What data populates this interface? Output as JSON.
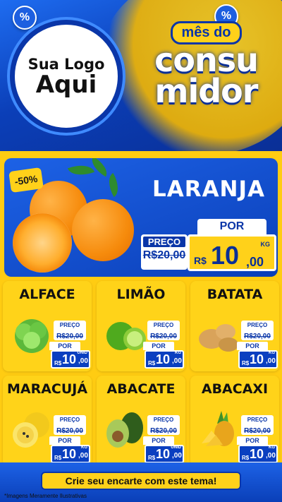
{
  "header": {
    "logo_line1": "Sua Logo",
    "logo_line2": "Aqui",
    "campaign_small": "mês do",
    "campaign_line1": "consu",
    "campaign_line2": "midor",
    "percent_icon": "%"
  },
  "featured": {
    "discount": "-50%",
    "name": "LARANJA",
    "preco_label": "PREÇO",
    "old_price": "R$20,00",
    "por_label": "POR",
    "currency": "R$",
    "price_int": "10",
    "price_dec": ",00",
    "unit": "KG"
  },
  "products": [
    {
      "name": "ALFACE",
      "preco_label": "PREÇO",
      "old_price": "R$20,00",
      "por_label": "POR",
      "currency": "R$",
      "price_int": "10",
      "price_dec": ",00",
      "unit": "UNID"
    },
    {
      "name": "LIMÃO",
      "preco_label": "PREÇO",
      "old_price": "R$20,00",
      "por_label": "POR",
      "currency": "R$",
      "price_int": "10",
      "price_dec": ",00",
      "unit": "KG"
    },
    {
      "name": "BATATA",
      "preco_label": "PREÇO",
      "old_price": "R$20,00",
      "por_label": "POR",
      "currency": "R$",
      "price_int": "10",
      "price_dec": ",00",
      "unit": "KG"
    },
    {
      "name": "MARACUJÁ",
      "preco_label": "PREÇO",
      "old_price": "R$20,00",
      "por_label": "POR",
      "currency": "R$",
      "price_int": "10",
      "price_dec": ",00",
      "unit": "KG"
    },
    {
      "name": "ABACATE",
      "preco_label": "PREÇO",
      "old_price": "R$20,00",
      "por_label": "POR",
      "currency": "R$",
      "price_int": "10",
      "price_dec": ",00",
      "unit": "UNID"
    },
    {
      "name": "ABACAXI",
      "preco_label": "PREÇO",
      "old_price": "R$20,00",
      "por_label": "POR",
      "currency": "R$",
      "price_int": "10",
      "price_dec": ",00",
      "unit": "KG"
    }
  ],
  "cta": "Crie seu encarte com este tema!",
  "disclaimer": "*Imagens Meramente Ilustrativas",
  "colors": {
    "brand_blue": "#0a36a8",
    "accent_yellow": "#ffcc12"
  }
}
